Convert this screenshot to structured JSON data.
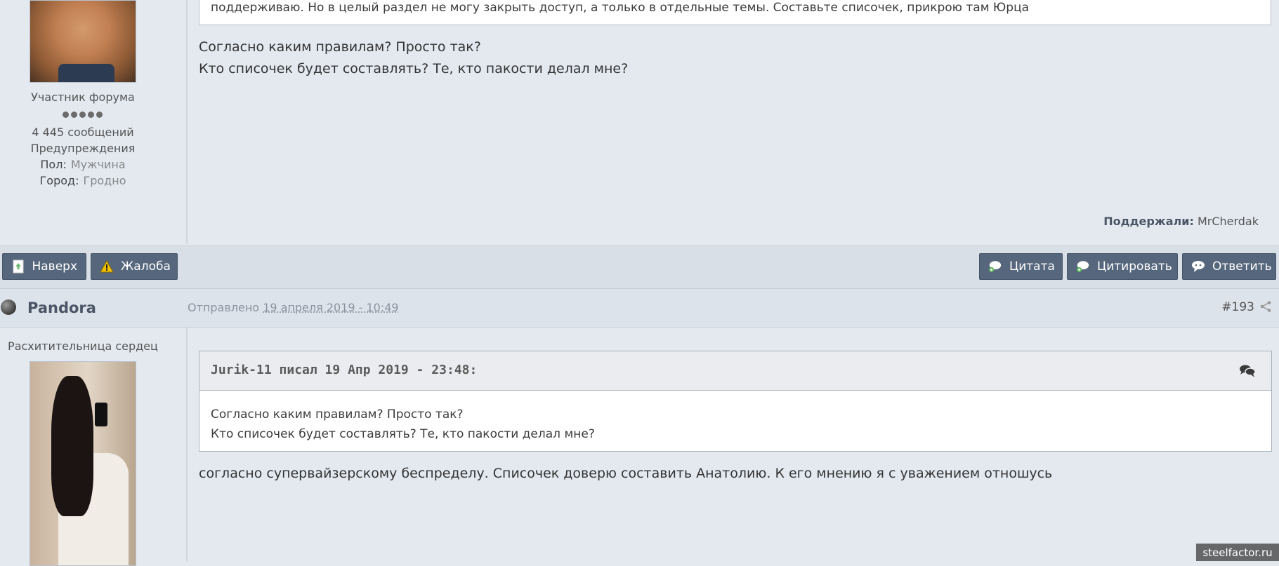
{
  "post1": {
    "user": {
      "title": "Участник форума",
      "posts": "4 445 сообщений",
      "warnings": "Предупреждения",
      "gender_label": "Пол:",
      "gender_value": "Мужчина",
      "city_label": "Город:",
      "city_value": "Гродно"
    },
    "quote_tail": "поддерживаю. Но в целый раздел не могу закрыть доступ, а только в отдельные темы. Составьте списочек, прикрою там Юрца",
    "lines": [
      "Согласно каким правилам? Просто так?",
      "Кто списочек будет составлять? Те, кто пакости делал мне?"
    ],
    "supported_label": "Поддержали:",
    "supported_user": "MrCherdak"
  },
  "buttons": {
    "top": "Наверх",
    "report": "Жалоба",
    "quote": "Цитата",
    "multiquote": "Цитировать",
    "reply": "Ответить"
  },
  "post2": {
    "author": "Pandora",
    "sent_label": "Отправлено",
    "sent_date": "19 апреля 2019 - 10:49",
    "number": "#193",
    "user_title": "Расхитительница сердец",
    "quote": {
      "header": "Jurik-11 писал 19 Апр 2019 - 23:48:",
      "lines": [
        "Согласно каким правилам? Просто так?",
        "Кто списочек будет составлять? Те, кто пакости делал мне?"
      ]
    },
    "text": "согласно супервайзерскому беспределу. Списочек доверю составить Анатолию. К его мнению я с уважением отношусь"
  },
  "watermark": "steelfactor.ru",
  "colors": {
    "background": "#e4e9f0",
    "button": "#56677d",
    "author": "#4a5566"
  }
}
